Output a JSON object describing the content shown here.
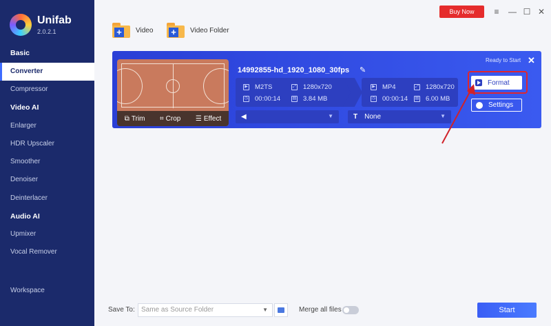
{
  "app": {
    "name": "Unifab",
    "version": "2.0.2.1",
    "buy_now": "Buy Now"
  },
  "window_controls": [
    "≡",
    "—",
    "☐",
    "✕"
  ],
  "sidebar": {
    "items": [
      {
        "label": "Basic",
        "type": "header"
      },
      {
        "label": "Converter",
        "type": "item",
        "active": true
      },
      {
        "label": "Compressor",
        "type": "item"
      },
      {
        "label": "Video AI",
        "type": "header"
      },
      {
        "label": "Enlarger",
        "type": "item"
      },
      {
        "label": "HDR Upscaler",
        "type": "item"
      },
      {
        "label": "Smoother",
        "type": "item"
      },
      {
        "label": "Denoiser",
        "type": "item"
      },
      {
        "label": "Deinterlacer",
        "type": "item"
      },
      {
        "label": "Audio AI",
        "type": "header"
      },
      {
        "label": "Upmixer",
        "type": "item"
      },
      {
        "label": "Vocal Remover",
        "type": "item"
      }
    ],
    "workspace": "Workspace"
  },
  "toolbar": {
    "add_video": "Video",
    "add_folder": "Video Folder"
  },
  "task": {
    "filename": "14992855-hd_1920_1080_30fps",
    "status": "Ready to Start",
    "thumb_actions": {
      "trim": "Trim",
      "crop": "Crop",
      "effect": "Effect"
    },
    "source": {
      "format": "M2TS",
      "resolution": "1280x720",
      "duration": "00:00:14",
      "size": "3.84 MB"
    },
    "output": {
      "format": "MP4",
      "resolution": "1280x720",
      "duration": "00:00:14",
      "size": "6.00 MB"
    },
    "audio_track": "",
    "subtitle": "None",
    "format_button": "Format",
    "settings_button": "Settings"
  },
  "bottom": {
    "save_to_label": "Save To:",
    "save_to_placeholder": "Same as Source Folder",
    "merge_label": "Merge all files",
    "merge_on": false,
    "start_button": "Start"
  },
  "colors": {
    "sidebar_bg": "#1b2a6b",
    "card_bg": "#2a3fd6",
    "buy_now": "#e52c2c",
    "highlight": "#e0262d",
    "start": "#3a5ef5"
  }
}
